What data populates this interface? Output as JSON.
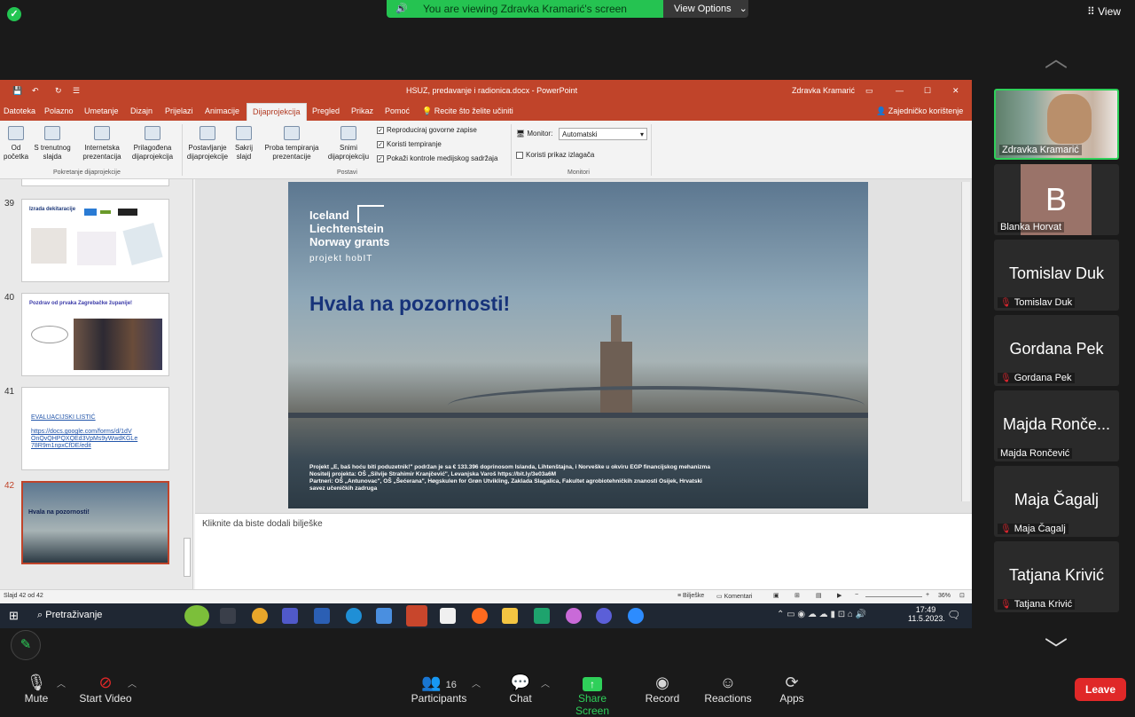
{
  "zoom": {
    "banner_text": "You are viewing Zdravka Kramarić's screen",
    "view_options": "View Options",
    "view_label": "View",
    "participants_count": "16",
    "toolbar": {
      "mute": "Mute",
      "start_video": "Start Video",
      "participants": "Participants",
      "chat": "Chat",
      "share_screen": "Share Screen",
      "record": "Record",
      "reactions": "Reactions",
      "apps": "Apps",
      "leave": "Leave"
    },
    "participants": [
      {
        "name": "Zdravka Kramarić",
        "big": "",
        "muted": false,
        "video": true
      },
      {
        "name": "Blanka Horvat",
        "big": "B",
        "muted": false,
        "video": false
      },
      {
        "name": "Tomislav Duk",
        "big": "Tomislav Duk",
        "muted": true,
        "video": false
      },
      {
        "name": "Gordana Pek",
        "big": "Gordana Pek",
        "muted": true,
        "video": false
      },
      {
        "name": "Majda Rončević",
        "big": "Majda Ronče...",
        "muted": false,
        "video": false
      },
      {
        "name": "Maja Čagalj",
        "big": "Maja Čagalj",
        "muted": true,
        "video": false
      },
      {
        "name": "Tatjana Krivić",
        "big": "Tatjana Krivić",
        "muted": true,
        "video": false
      }
    ]
  },
  "powerpoint": {
    "doc_title": "HSUZ, predavanje i radionica.docx  -  PowerPoint",
    "user": "Zdravka Kramarić",
    "menu": [
      "Datoteka",
      "Polazno",
      "Umetanje",
      "Dizajn",
      "Prijelazi",
      "Animacije",
      "Dijaprojekcija",
      "Pregled",
      "Prikaz",
      "Pomoć"
    ],
    "tell_me": "Recite što želite učiniti",
    "share": "Zajedničko korištenje",
    "ribbon": {
      "from_start": [
        "Od",
        "početka"
      ],
      "from_current": [
        "S trenutnog",
        "slajda"
      ],
      "online": [
        "Internetska",
        "prezentacija"
      ],
      "custom": [
        "Prilagođena",
        "dijaprojekcija"
      ],
      "group_start": "Pokretanje dijaprojekcije",
      "setup": [
        "Postavljanje",
        "dijaprojekcije"
      ],
      "hide": [
        "Sakrij",
        "slajd"
      ],
      "rehearse": [
        "Proba tempiranja",
        "prezentacije"
      ],
      "record": [
        "Snimi",
        "dijaprojekciju"
      ],
      "group_setup": "Postavi",
      "chk_narration": "Reproduciraj govorne zapise",
      "chk_timings": "Koristi tempiranje",
      "chk_media": "Pokaži kontrole medijskog sadržaja",
      "monitor_label": "Monitor:",
      "monitor_value": "Automatski",
      "presenter_view": "Koristi prikaz izlagača",
      "group_monitors": "Monitori"
    },
    "slides": [
      {
        "num": "39",
        "title": "Izrada dekitaracije"
      },
      {
        "num": "40",
        "title": "Pozdrav od prvaka Zagrebačke županije!"
      },
      {
        "num": "41",
        "title": "EVALUACIJSKI LISTIĆ",
        "link": "https://docs.google.com/forms/d/1dV OnQvQHPQXQEd3VpMs9yWwdKGLe 78R9m1npxCfDE/edit"
      },
      {
        "num": "42",
        "title": "Hvala na pozornosti!"
      }
    ],
    "slide_main": {
      "logo_line1": "Iceland",
      "logo_line2": "Liechtenstein",
      "logo_line3": "Norway grants",
      "logo_project": "projekt hobIT",
      "heading": "Hvala na pozornosti!",
      "footer1": "Projekt „E, baš hoću biti poduzetnik!\" podržan je sa € 133.396 doprinosom Islanda, Lihtenštajna, i Norveške u okviru EGP financijskog mehanizma",
      "footer2": "Nositelj projekta: OŠ „Silvije Strahimir Kranjčević\", Levanjska Varoš                   https://bit.ly/3e03a6M",
      "footer3": "Partneri: OŠ „Antunovac\", OŠ „Šećerana\", Høgskulen for Grøn Utvikling, Zaklada Slagalica, Fakultet agrobiotehničkih znanosti Osijek, Hrvatski savez učeničkih zadruga"
    },
    "notes_placeholder": "Kliknite da biste dodali bilješke",
    "status": {
      "slide_count": "Slajd 42 od 42",
      "notes": "Bilješke",
      "comments": "Komentari",
      "zoom": "36%"
    },
    "taskbar": {
      "search": "Pretraživanje",
      "time": "17:49",
      "date": "11.5.2023."
    }
  }
}
